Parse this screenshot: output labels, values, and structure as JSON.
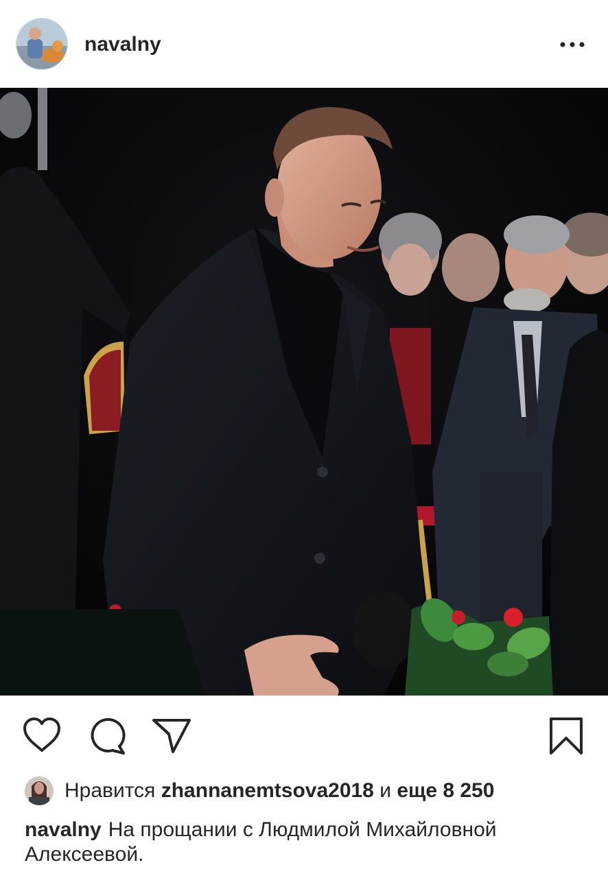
{
  "post": {
    "username": "navalny",
    "more_icon": "more-horizontal-icon"
  },
  "actions": {
    "like_icon": "heart-outline-icon",
    "comment_icon": "comment-bubble-icon",
    "share_icon": "paper-plane-icon",
    "save_icon": "bookmark-outline-icon"
  },
  "likes": {
    "prefix": "Нравится",
    "liker": "zhannanemtsova2018",
    "joiner": "и",
    "more": "еще 8 250"
  },
  "caption": {
    "username": "navalny",
    "text": "На прощании с Людмилой Михайловной Алексеевой."
  }
}
